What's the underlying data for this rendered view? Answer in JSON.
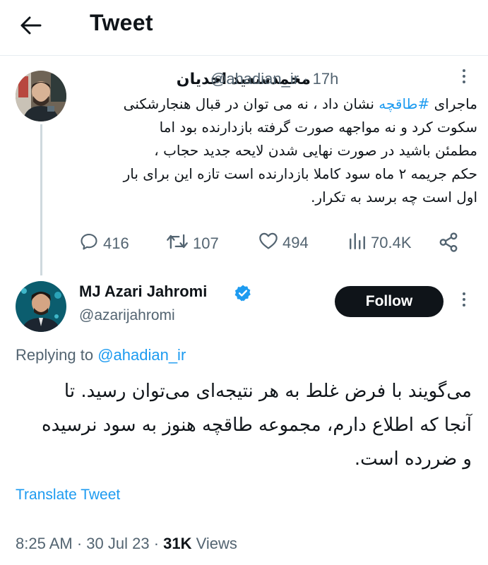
{
  "header": {
    "title": "Tweet",
    "back_icon": "arrow-left-icon"
  },
  "parent_tweet": {
    "display_name": "محمدسعید احدیان",
    "handle": "@ahadian_ir",
    "separator": "·",
    "time": "17h",
    "text_lines": [
      {
        "before": "ماجرای ",
        "hashtag": "#طاقچه",
        "after": " نشان داد ، نه می توان در قبال هنجارشکنی"
      },
      {
        "text": "سکوت کرد و نه مواجهه صورت گرفته بازدارنده بود  اما"
      },
      {
        "text": "مطمئن باشید در صورت نهایی شدن لایحه جدید حجاب ،"
      },
      {
        "text": "حکم جریمه ۲ ماه سود  کاملا بازدارنده است تازه این برای بار"
      },
      {
        "text": "اول است چه برسد به تکرار."
      }
    ],
    "actions": {
      "replies": "416",
      "retweets": "107",
      "likes": "494",
      "views": "70.4K"
    }
  },
  "main_tweet": {
    "display_name": "MJ Azari Jahromi",
    "handle": "@azarijahromi",
    "follow_label": "Follow",
    "replying_prefix": "Replying to ",
    "replying_handle": "@ahadian_ir",
    "text_lines": [
      "می‌گویند با فرض غلط به هر نتیجه‌ای می‌توان رسید. تا",
      "آنجا که اطلاع دارم، مجموعه طاقچه هنوز به سود نرسیده",
      "و ضررده است."
    ],
    "translate_label": "Translate Tweet",
    "time": "8:25 AM",
    "dot1": " · ",
    "date": "30 Jul 23",
    "dot2": " · ",
    "views_count": "31K",
    "views_label": " Views"
  },
  "colors": {
    "accent": "#1d9bf0",
    "text": "#0f1419",
    "muted": "#536471",
    "verified": "#1d9bf0"
  }
}
